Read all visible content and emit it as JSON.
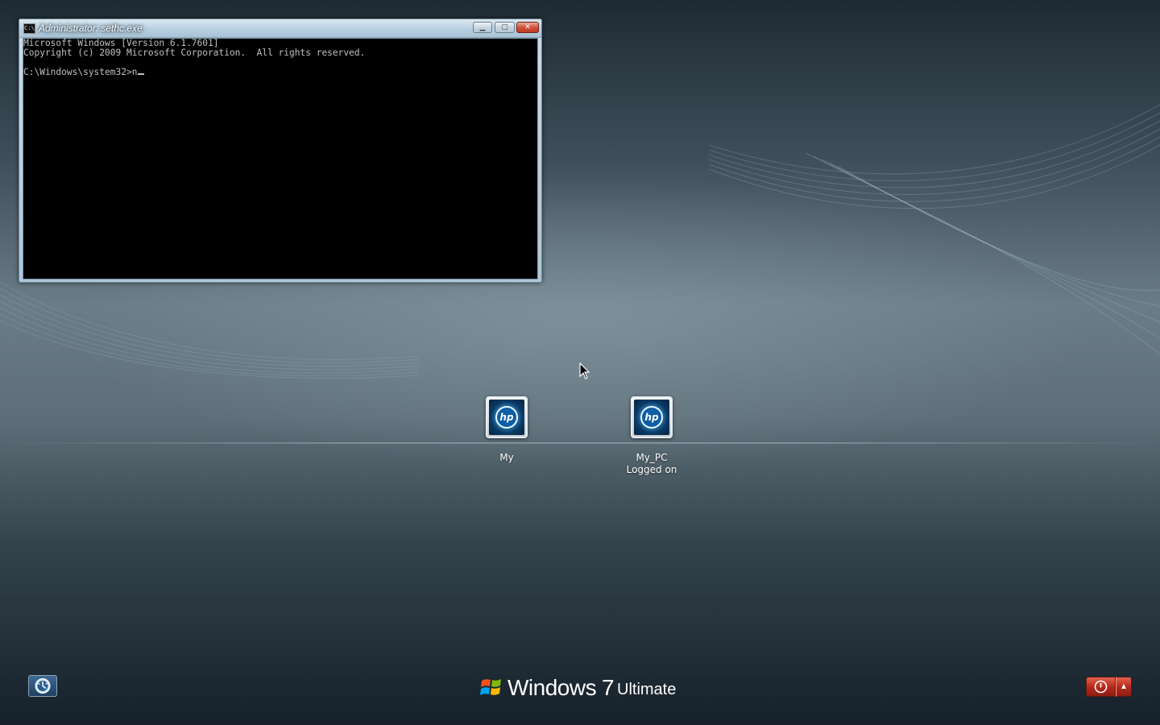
{
  "console_window": {
    "title": "Administrator: sethc.exe",
    "app_icon_text": "C:\\",
    "minimize_glyph": "▁",
    "maximize_glyph": "▢",
    "close_glyph": "✕",
    "lines": [
      "Microsoft Windows [Version 6.1.7601]",
      "Copyright (c) 2009 Microsoft Corporation.  All rights reserved.",
      "",
      "C:\\Windows\\system32>n"
    ]
  },
  "users": [
    {
      "name": "My",
      "status": "",
      "avatar_icon": "hp-logo-icon",
      "avatar_text": "hp"
    },
    {
      "name": "My_PC",
      "status": "Logged on",
      "avatar_icon": "hp-logo-icon",
      "avatar_text": "hp"
    }
  ],
  "branding": {
    "product": "Windows",
    "version": "7",
    "edition": "Ultimate"
  },
  "controls": {
    "ease_of_access_icon": "ease-of-access-icon",
    "shutdown_icon": "power-icon",
    "shutdown_menu_glyph": "▲"
  },
  "colors": {
    "console_background": "#000000",
    "console_text": "#c0c0c0",
    "shutdown_red": "#b3281a",
    "accent_blue": "#1d3f63"
  }
}
